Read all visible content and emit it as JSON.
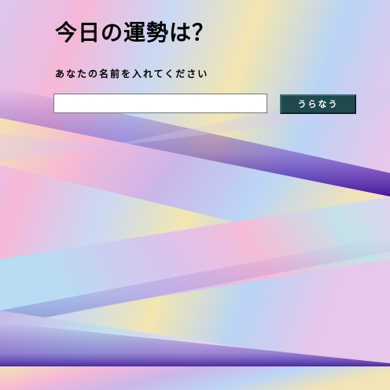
{
  "page": {
    "title": "今日の運勢は？",
    "prompt": "あなたの名前を入れてください"
  },
  "form": {
    "name_input_value": "",
    "name_input_placeholder": "",
    "submit_label": "うらなう"
  },
  "colors": {
    "button_background": "#1f4a4d",
    "text": "#000000",
    "background_pastels": [
      "#f6b8d8",
      "#b8d8f6",
      "#f3e6b0",
      "#cdb6ea",
      "#4a1aa8"
    ]
  }
}
